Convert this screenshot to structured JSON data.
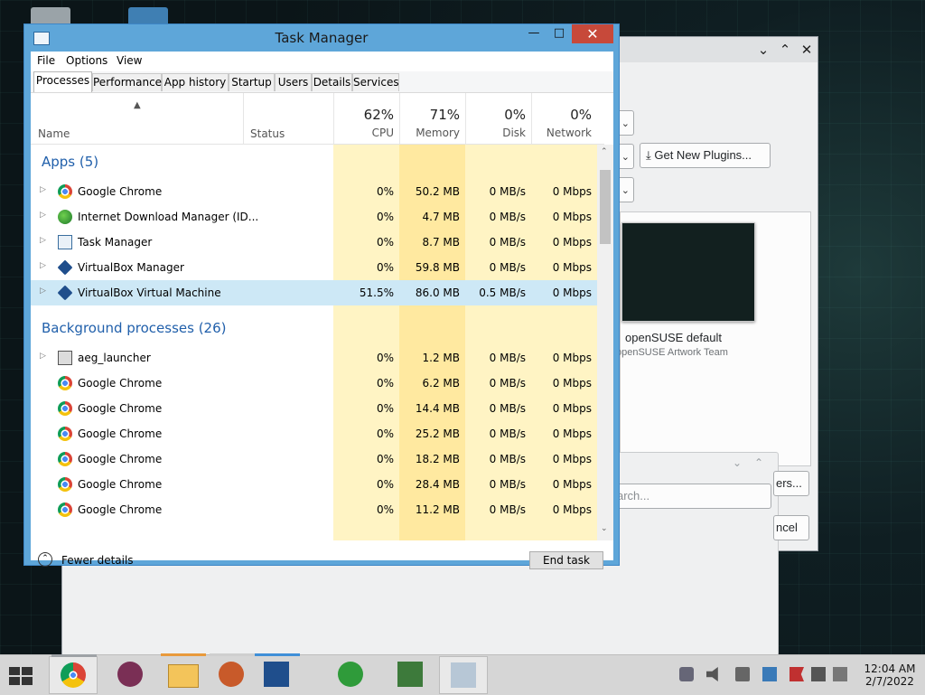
{
  "task_manager": {
    "title": "Task Manager",
    "menu": [
      "File",
      "Options",
      "View"
    ],
    "tabs": [
      "Processes",
      "Performance",
      "App history",
      "Startup",
      "Users",
      "Details",
      "Services"
    ],
    "active_tab": "Processes",
    "columns": {
      "name": "Name",
      "status": "Status",
      "cpu": {
        "pct": "62%",
        "label": "CPU"
      },
      "memory": {
        "pct": "71%",
        "label": "Memory"
      },
      "disk": {
        "pct": "0%",
        "label": "Disk"
      },
      "network": {
        "pct": "0%",
        "label": "Network"
      }
    },
    "groups": [
      {
        "title": "Apps (5)"
      },
      {
        "title": "Background processes (26)"
      }
    ],
    "apps": [
      {
        "name": "Google Chrome",
        "icon": "chrome-icon",
        "cpu": "0%",
        "memory": "50.2 MB",
        "disk": "0 MB/s",
        "network": "0 Mbps"
      },
      {
        "name": "Internet Download Manager (ID...",
        "icon": "idm-icon",
        "cpu": "0%",
        "memory": "4.7 MB",
        "disk": "0 MB/s",
        "network": "0 Mbps"
      },
      {
        "name": "Task Manager",
        "icon": "task-manager-icon",
        "cpu": "0%",
        "memory": "8.7 MB",
        "disk": "0 MB/s",
        "network": "0 Mbps"
      },
      {
        "name": "VirtualBox Manager",
        "icon": "virtualbox-icon",
        "cpu": "0%",
        "memory": "59.8 MB",
        "disk": "0 MB/s",
        "network": "0 Mbps"
      },
      {
        "name": "VirtualBox Virtual Machine",
        "icon": "virtualbox-icon",
        "cpu": "51.5%",
        "memory": "86.0 MB",
        "disk": "0.5 MB/s",
        "network": "0 Mbps",
        "selected": true
      }
    ],
    "background": [
      {
        "name": "aeg_launcher",
        "icon": "aeg-launcher-icon",
        "cpu": "0%",
        "memory": "1.2 MB",
        "disk": "0 MB/s",
        "network": "0 Mbps"
      },
      {
        "name": "Google Chrome",
        "icon": "chrome-icon",
        "cpu": "0%",
        "memory": "6.2 MB",
        "disk": "0 MB/s",
        "network": "0 Mbps"
      },
      {
        "name": "Google Chrome",
        "icon": "chrome-icon",
        "cpu": "0%",
        "memory": "14.4 MB",
        "disk": "0 MB/s",
        "network": "0 Mbps"
      },
      {
        "name": "Google Chrome",
        "icon": "chrome-icon",
        "cpu": "0%",
        "memory": "25.2 MB",
        "disk": "0 MB/s",
        "network": "0 Mbps"
      },
      {
        "name": "Google Chrome",
        "icon": "chrome-icon",
        "cpu": "0%",
        "memory": "18.2 MB",
        "disk": "0 MB/s",
        "network": "0 Mbps"
      },
      {
        "name": "Google Chrome",
        "icon": "chrome-icon",
        "cpu": "0%",
        "memory": "28.4 MB",
        "disk": "0 MB/s",
        "network": "0 Mbps"
      },
      {
        "name": "Google Chrome",
        "icon": "chrome-icon",
        "cpu": "0%",
        "memory": "11.2 MB",
        "disk": "0 MB/s",
        "network": "0 Mbps"
      }
    ],
    "fewer_details": "Fewer details",
    "end_task": "End task",
    "colors": {
      "title_bar": "#5ea6d9",
      "close": "#c7493a",
      "heat_light": "#fff4c4",
      "heat_strong": "#ffe9a0",
      "group": "#2160ab",
      "selected": "#cde8f6"
    }
  },
  "kde_dialog": {
    "get_new_plugins": "Get New Plugins...",
    "theme_name": "openSUSE default",
    "theme_author": "openSUSE Artwork Team",
    "search_placeholder": "arch...",
    "partial_button_1": "ers...",
    "partial_button_2": "ncel"
  },
  "taskbar": {
    "apps": [
      "chrome",
      "firefox",
      "file-explorer",
      "paint",
      "virtualbox",
      "internet-download-manager",
      "app-64bit",
      "task-manager"
    ],
    "clock": {
      "time": "12:04 AM",
      "date": "2/7/2022"
    }
  }
}
